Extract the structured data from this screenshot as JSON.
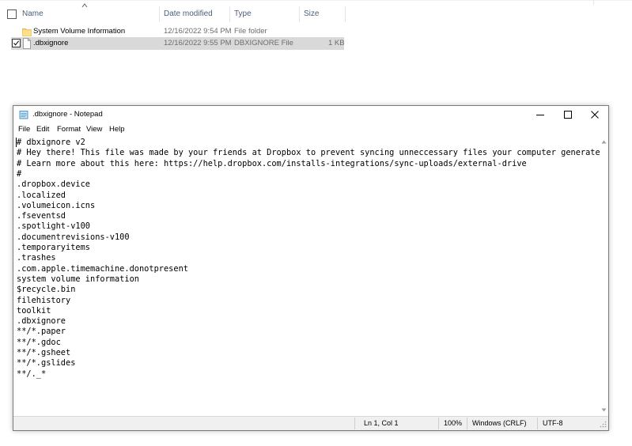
{
  "explorer": {
    "columns": {
      "name": "Name",
      "date_modified": "Date modified",
      "type": "Type",
      "size": "Size"
    },
    "rows": [
      {
        "name": "System Volume Information",
        "date": "12/16/2022 9:54 PM",
        "type": "File folder",
        "size": "",
        "icon": "folder-icon",
        "selected": false
      },
      {
        "name": ".dbxignore",
        "date": "12/16/2022 9:55 PM",
        "type": "DBXIGNORE File",
        "size": "1 KB",
        "icon": "file-icon",
        "selected": true
      }
    ]
  },
  "notepad": {
    "title": ".dbxignore - Notepad",
    "menu": [
      "File",
      "Edit",
      "Format",
      "View",
      "Help"
    ],
    "lines": [
      "# dbxignore v2",
      "# Hey there! This file was made by your friends at Dropbox to prevent syncing unneccessary files your computer generates.",
      "# Learn more about this here: https://help.dropbox.com/installs-integrations/sync-uploads/external-drive",
      "#",
      ".dropbox.device",
      ".localized",
      ".volumeicon.icns",
      ".fseventsd",
      ".spotlight-v100",
      ".documentrevisions-v100",
      ".temporaryitems",
      ".trashes",
      ".com.apple.timemachine.donotpresent",
      "system volume information",
      "$recycle.bin",
      "filehistory",
      "toolkit",
      ".dbxignore",
      "**/*.paper",
      "**/*.gdoc",
      "**/*.gsheet",
      "**/*.gslides",
      "**/._*"
    ],
    "status": {
      "position": "Ln 1, Col 1",
      "zoom": "100%",
      "line_ending": "Windows (CRLF)",
      "encoding": "UTF-8"
    }
  },
  "colors": {
    "folder": "#f8d775",
    "selected_row": "#d9d9d9",
    "statusbar": "#f0f0f0",
    "header_text": "#4c607a"
  }
}
